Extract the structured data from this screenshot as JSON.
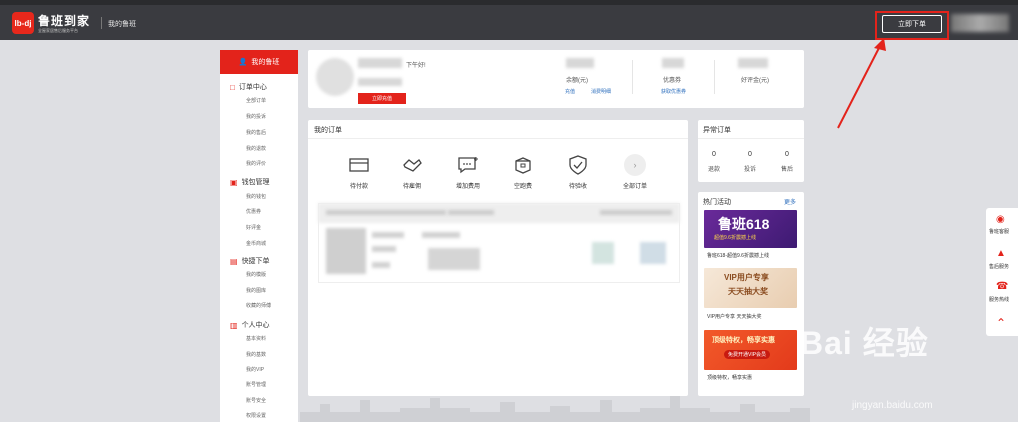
{
  "header": {
    "logo_mark": "lb-dj",
    "logo_text": "鲁班到家",
    "slogan": "全屋家居售后服务平台",
    "nav_title": "我的鲁班",
    "order_now": "立即下单"
  },
  "sidebar": {
    "active": "我的鲁班",
    "groups": [
      {
        "title": "订单中心",
        "items": [
          "全部订单",
          "我的投诉",
          "我的售后",
          "我的退款",
          "我的评价"
        ]
      },
      {
        "title": "钱包管理",
        "items": [
          "我的钱包",
          "优惠券",
          "好评金",
          "金币商城"
        ]
      },
      {
        "title": "快捷下单",
        "items": [
          "我的模版",
          "我的图库",
          "收藏的师傅"
        ]
      },
      {
        "title": "个人中心",
        "items": [
          "基本资料",
          "我的基数",
          "我的VIP",
          "账号管理",
          "账号安全",
          "权限设置"
        ]
      }
    ]
  },
  "profile": {
    "greeting": "下午好!",
    "recharge_button": "立即充值",
    "balance_label": "余额(元)",
    "recharge_link": "充值",
    "consume_link": "消费明细",
    "coupon_label": "优惠券",
    "coupon_link": "获取优惠券",
    "goodreview_label": "好评金(元)"
  },
  "my_orders": {
    "title": "我的订单",
    "statuses": [
      {
        "label": "待付款",
        "icon": "payment-card-icon"
      },
      {
        "label": "待雇佣",
        "icon": "handshake-icon"
      },
      {
        "label": "增加费用",
        "icon": "add-fee-icon"
      },
      {
        "label": "空跑费",
        "icon": "box-icon"
      },
      {
        "label": "待验收",
        "icon": "shield-check-icon"
      },
      {
        "label": "全部订单",
        "icon": "chevron-right-icon"
      }
    ]
  },
  "abnormal": {
    "title": "异常订单",
    "items": [
      {
        "count": "0",
        "label": "退款"
      },
      {
        "count": "0",
        "label": "投诉"
      },
      {
        "count": "0",
        "label": "售后"
      }
    ]
  },
  "activities": {
    "title": "热门活动",
    "more": "更多",
    "banners": [
      {
        "headline": "鲁班618",
        "sub": "超值9.6折震撼上线",
        "caption": "鲁班618-超值9.6折震撼上线"
      },
      {
        "headline": "VIP用户专享",
        "sub": "天天抽大奖",
        "caption": "VIP用户专享 天天抽大奖"
      },
      {
        "headline": "顶级特权，畅享实惠",
        "sub": "免费开通VIP会员",
        "caption": "顶级特权，畅享实惠"
      }
    ]
  },
  "float_bar": {
    "items": [
      {
        "label": "鲁班客服",
        "icon": "headset-icon"
      },
      {
        "label": "售后服务",
        "icon": "megaphone-icon"
      },
      {
        "label": "服务热线",
        "icon": "phone-icon"
      },
      {
        "label": "",
        "icon": "back-to-top-icon"
      }
    ]
  },
  "watermark": {
    "brand": "Bai 经验",
    "url": "jingyan.baidu.com"
  },
  "colors": {
    "accent": "#e3231b",
    "header_bg": "#3a3b40",
    "link": "#2e6fbd"
  }
}
